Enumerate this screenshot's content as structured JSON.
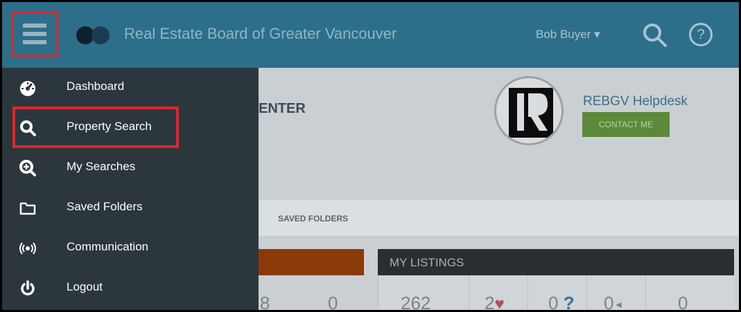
{
  "header": {
    "title": "Real Estate Board of Greater Vancouver",
    "user_menu": "Bob Buyer ▾",
    "help_glyph": "?",
    "bar_color": "#2d6f8a"
  },
  "sidebar": {
    "items": [
      {
        "label": "Dashboard",
        "icon": "dashboard-icon",
        "glyph": "◕"
      },
      {
        "label": "Property Search",
        "icon": "search-icon",
        "glyph": "🔍"
      },
      {
        "label": "My Searches",
        "icon": "search-plus-icon",
        "glyph": "⊕"
      },
      {
        "label": "Saved Folders",
        "icon": "folder-icon",
        "glyph": "▭"
      },
      {
        "label": "Communication",
        "icon": "broadcast-icon",
        "glyph": "((•))"
      },
      {
        "label": "Logout",
        "icon": "power-icon",
        "glyph": "⏻"
      }
    ],
    "highlight_color": "#e3242b"
  },
  "main": {
    "title_fragment": "ENTER",
    "helpdesk_name": "REBGV Helpdesk",
    "contact_label": "CONTACT ME",
    "tab_saved_folders": "SAVED FOLDERS",
    "listings_header": "MY LISTINGS",
    "left_stats": [
      "8",
      "0"
    ],
    "listing_stats": {
      "total": "262",
      "favorites": "2",
      "questions": "0",
      "announcements": "0",
      "other": "0"
    }
  }
}
